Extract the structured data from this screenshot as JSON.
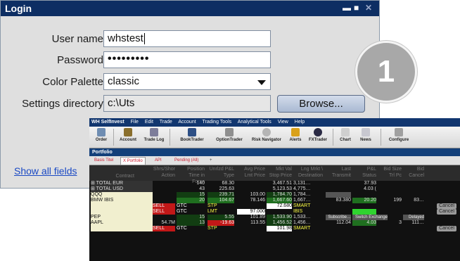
{
  "login": {
    "title": "Login",
    "username_label": "User name",
    "username_value": "whstest",
    "password_label": "Password",
    "password_value": "•••••••••",
    "palette_label": "Color Palette",
    "palette_value": "classic",
    "settings_label": "Settings directory",
    "settings_value": "c:\\Uts",
    "browse_label": "Browse...",
    "show_all_fields": "Show all fields"
  },
  "badge": {
    "number": "1"
  },
  "tws": {
    "menu": {
      "app": "WH SelfInvest",
      "items": [
        "File",
        "Edit",
        "Trade",
        "Account",
        "Trading Tools",
        "Analytical Tools",
        "View",
        "Help"
      ]
    },
    "toolbar": [
      "Order",
      "Account",
      "Trade Log",
      "BookTrader",
      "OptionTrader",
      "Risk Navigator",
      "Alerts",
      "FXTrader",
      "Chart",
      "News",
      "Configure"
    ],
    "section": "Portfolio",
    "tabs": [
      "Basis Titel",
      "X Portfolio",
      "API",
      "Pending (All)",
      "+"
    ],
    "headers": {
      "contract": "Contract",
      "h1": "Shrs/Shor Action",
      "h2": "Position Time in Force",
      "h3": "Unrlzd P&L Type",
      "h4": "Avg Price Lmt Price",
      "h5": "Mkt Val Stop Price",
      "h6": "Lng Mrkt \\ Destination",
      "h7": "Last Transmit",
      "h8": "P&L Status",
      "h9": "Bid Size Trl Pc",
      "h10": "Bid Cancel"
    },
    "rows": [
      {
        "sym": "⊞ TOTAL  EUR",
        "position": "140",
        "pnl": "68.30",
        "mktval": "3,467.51",
        "lng": "3,131…",
        "plnl": "37.93"
      },
      {
        "sym": "⊞ TOTAL  USD",
        "position": "43",
        "pnl": "225.63",
        "mktval": "5,123.53",
        "lng": "4,775…",
        "plnl": "4.03 ("
      },
      {
        "sym": "QQQ",
        "position": "15",
        "pnl": "239.71",
        "avg": "103.00",
        "mktval": "1,784.70",
        "lng": "1,784…"
      },
      {
        "sym": "BMW IBIS",
        "position": "20",
        "pnl": "104.67",
        "avg": "78.146",
        "mktval": "1,667.60",
        "lng": "1,667…",
        "last": "83.380",
        "plnl": "20.20",
        "bsz": "199",
        "bid": "83…"
      },
      {
        "action": "SELL",
        "tif": "GTC",
        "type": "STP",
        "stop": "72.680",
        "dest": "SMART",
        "cancel": "Cancel"
      },
      {
        "action": "SELL",
        "tif": "GTC",
        "type": "LMT",
        "lmt": "97.000",
        "dest": "IBIS",
        "cancel": "Cancel"
      },
      {
        "sym": "PEP",
        "position": "15",
        "pnl": "5.55",
        "avg": "101.89",
        "mktval": "1,533.90",
        "lng": "1,533…",
        "last": "Subscribe…",
        "plnl": "Switch Exchange",
        "bid": "Delayed",
        "cancel": ""
      },
      {
        "sym": "AAPL",
        "shrs": "54.7M",
        "position": "13",
        "pnl": "-19.63",
        "avg": "113.55",
        "mktval": "1,456.52",
        "lng": "1,456…",
        "last": "112.04",
        "plnl": "4.03",
        "bsz": "3",
        "bid": "111…"
      },
      {
        "action": "SELL",
        "tif": "GTC",
        "type": "STP",
        "stop": "101.98",
        "dest": "SMART",
        "cancel": "Cancel"
      }
    ]
  }
}
